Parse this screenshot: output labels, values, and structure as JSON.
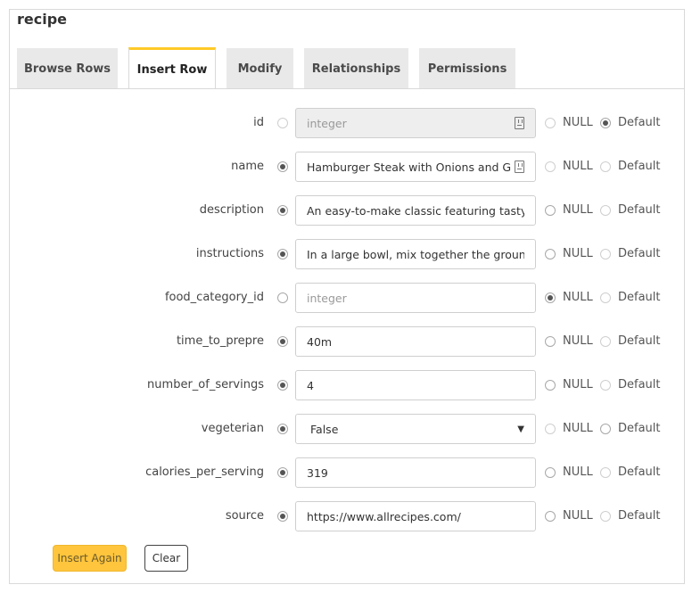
{
  "page": {
    "title": "recipe"
  },
  "tabs": [
    {
      "label": "Browse Rows"
    },
    {
      "label": "Insert Row"
    },
    {
      "label": "Modify"
    },
    {
      "label": "Relationships"
    },
    {
      "label": "Permissions"
    }
  ],
  "options": {
    "null_label": "NULL",
    "default_label": "Default"
  },
  "fields": {
    "id": {
      "label": "id",
      "value": "",
      "placeholder": "integer",
      "selected": "default"
    },
    "name": {
      "label": "name",
      "value": "Hamburger Steak with Onions and Gravy",
      "selected": "value"
    },
    "description": {
      "label": "description",
      "value": "An easy-to-make classic featuring tasty ha",
      "selected": "value"
    },
    "instructions": {
      "label": "instructions",
      "value": "In a large bowl, mix together the ground",
      "selected": "value"
    },
    "food_category_id": {
      "label": "food_category_id",
      "value": "",
      "placeholder": "integer",
      "selected": "null"
    },
    "time_to_prepre": {
      "label": "time_to_prepre",
      "value": "40m",
      "selected": "value"
    },
    "number_of_servings": {
      "label": "number_of_servings",
      "value": "4",
      "selected": "value"
    },
    "vegeterian": {
      "label": "vegeterian",
      "value": "False",
      "selected": "value"
    },
    "calories_per_serving": {
      "label": "calories_per_serving",
      "value": "319",
      "selected": "value"
    },
    "source": {
      "label": "source",
      "value": "https://www.allrecipes.com/",
      "selected": "value"
    }
  },
  "buttons": {
    "insert_again": "Insert Again",
    "clear": "Clear"
  },
  "colors": {
    "accent": "#ffca27",
    "insert_button": "#fec53d"
  }
}
